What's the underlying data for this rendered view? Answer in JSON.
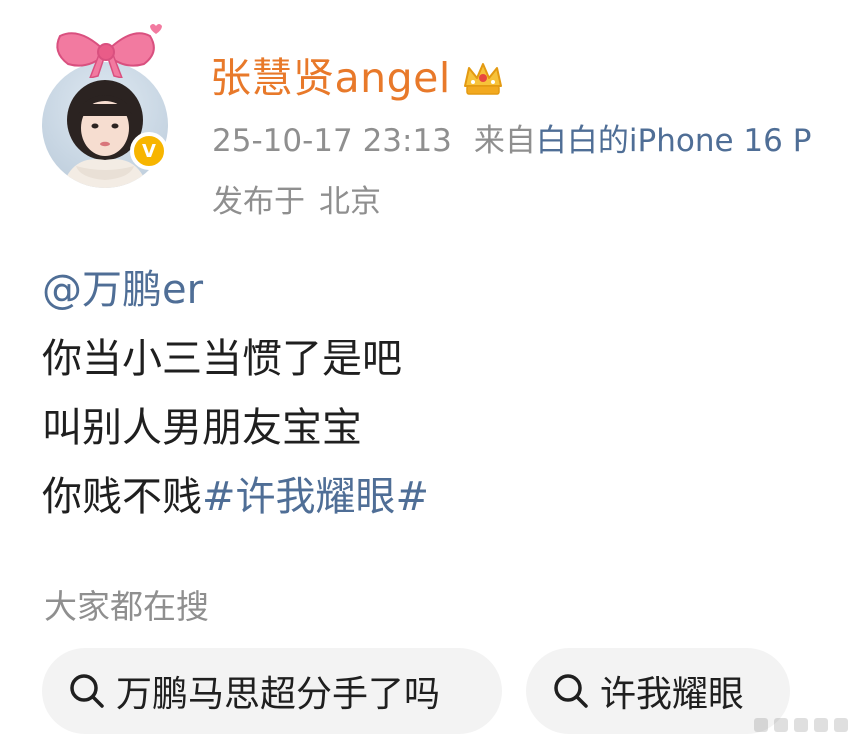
{
  "author": {
    "name": "张慧贤angel",
    "verified_badge": "V",
    "avatar_icon": "avatar-photo",
    "crown_icon": "gold-crown-icon",
    "colors": {
      "name": "#e8792a",
      "verified": "#f7b500"
    }
  },
  "meta": {
    "datetime": "25-10-17 23:13",
    "source_prefix": "来自",
    "source_device": "白白的iPhone 16 P",
    "location_prefix": "发布于",
    "location": "北京"
  },
  "post": {
    "mention": "@万鹏er",
    "line1": "你当小三当惯了是吧",
    "line2": "叫别人男朋友宝宝",
    "line3_text": "你贱不贱",
    "line3_hashtag": "#许我耀眼#",
    "link_color": "#4f6e96"
  },
  "search": {
    "title": "大家都在搜",
    "chips": [
      {
        "label": "万鹏马思超分手了吗",
        "icon": "search-icon"
      },
      {
        "label": "许我耀眼",
        "icon": "search-icon"
      }
    ]
  }
}
